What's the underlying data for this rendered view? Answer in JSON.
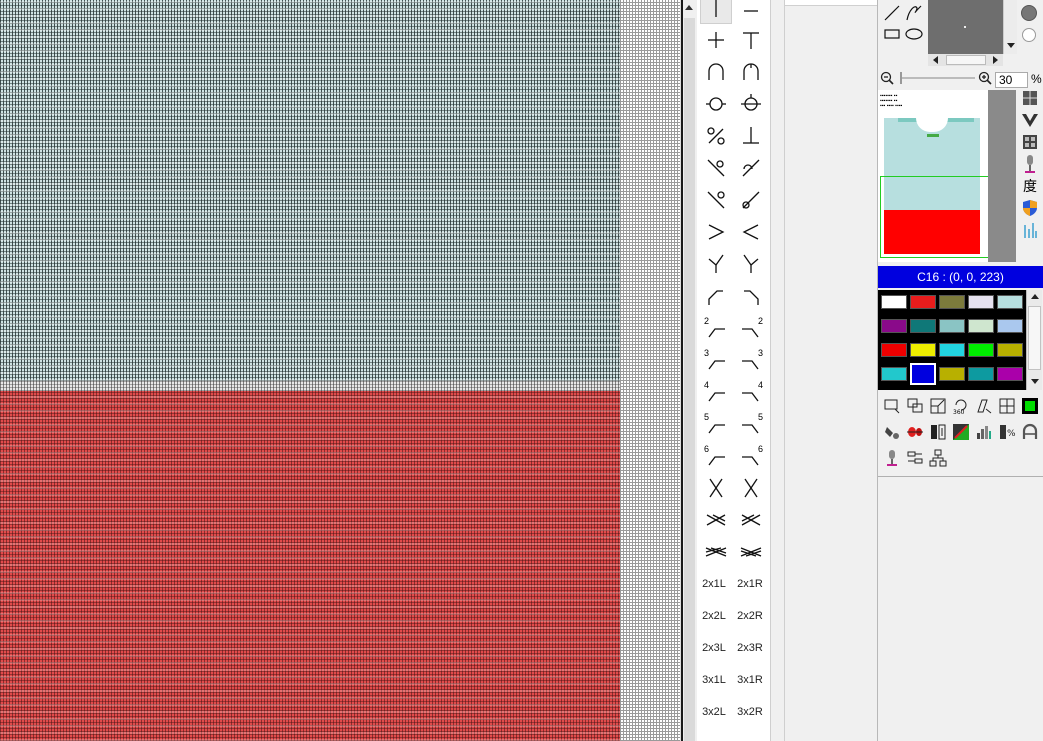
{
  "canvas": {
    "upper_color": "#b7dfdf",
    "lower_color": "#ff0000"
  },
  "stitch_palette": {
    "text_symbols": [
      {
        "left": "2x1L",
        "right": "2x1R"
      },
      {
        "left": "2x2L",
        "right": "2x2R"
      },
      {
        "left": "2x3L",
        "right": "2x3R"
      },
      {
        "left": "3x1L",
        "right": "3x1R"
      },
      {
        "left": "3x2L",
        "right": "3x2R"
      }
    ],
    "numbered_rows": [
      "2",
      "3",
      "4",
      "5",
      "6"
    ]
  },
  "zoom": {
    "value": "30",
    "unit": "%"
  },
  "side_tools": {
    "degree_label": "度"
  },
  "color_selector": {
    "title": "C16 : (0, 0, 223)",
    "selected_color": "#0000df",
    "swatches": [
      [
        "#ffffff",
        "#e81c1c",
        "#7c7b3c",
        "#e6e2f0",
        "#b7dfdf"
      ],
      [
        "#8a0a8a",
        "#0f7878",
        "#8ac4c4",
        "#cfe6cf",
        "#aac8ee"
      ],
      [
        "#ee0000",
        "#eeee00",
        "#22d4e0",
        "#00ee00",
        "#b8b000"
      ],
      [
        "#22c8cc",
        "#0000df",
        "#b8b000",
        "#0d9aa0",
        "#aa00aa"
      ]
    ]
  }
}
